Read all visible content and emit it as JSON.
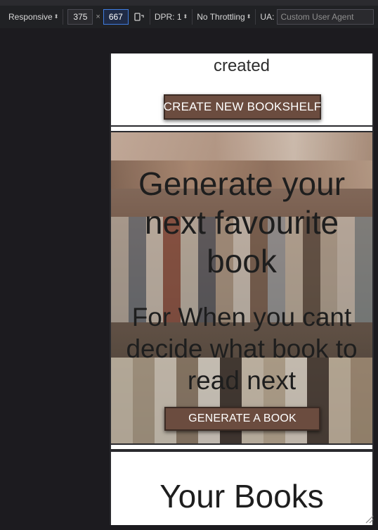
{
  "toolbar": {
    "device": "Responsive",
    "width": "375",
    "height": "667",
    "dpr_label": "DPR: 1",
    "throttling": "No Throttling",
    "ua_label": "UA:",
    "ua_placeholder": "Custom User Agent",
    "times": "×"
  },
  "page": {
    "created_text": "created",
    "create_button": "CREATE NEW BOOKSHELF",
    "hero_title": "Generate your next favourite book",
    "hero_subtitle": "For When you cant decide what book to read next",
    "generate_button": "GENERATE A BOOK",
    "books_title": "Your Books"
  },
  "colors": {
    "button_bg": "#6b4c3f",
    "button_border": "#3b2b24",
    "devtools_bg": "#202124"
  },
  "icons": [
    "rotate-icon",
    "caret-icon",
    "resize-handle-icon"
  ]
}
